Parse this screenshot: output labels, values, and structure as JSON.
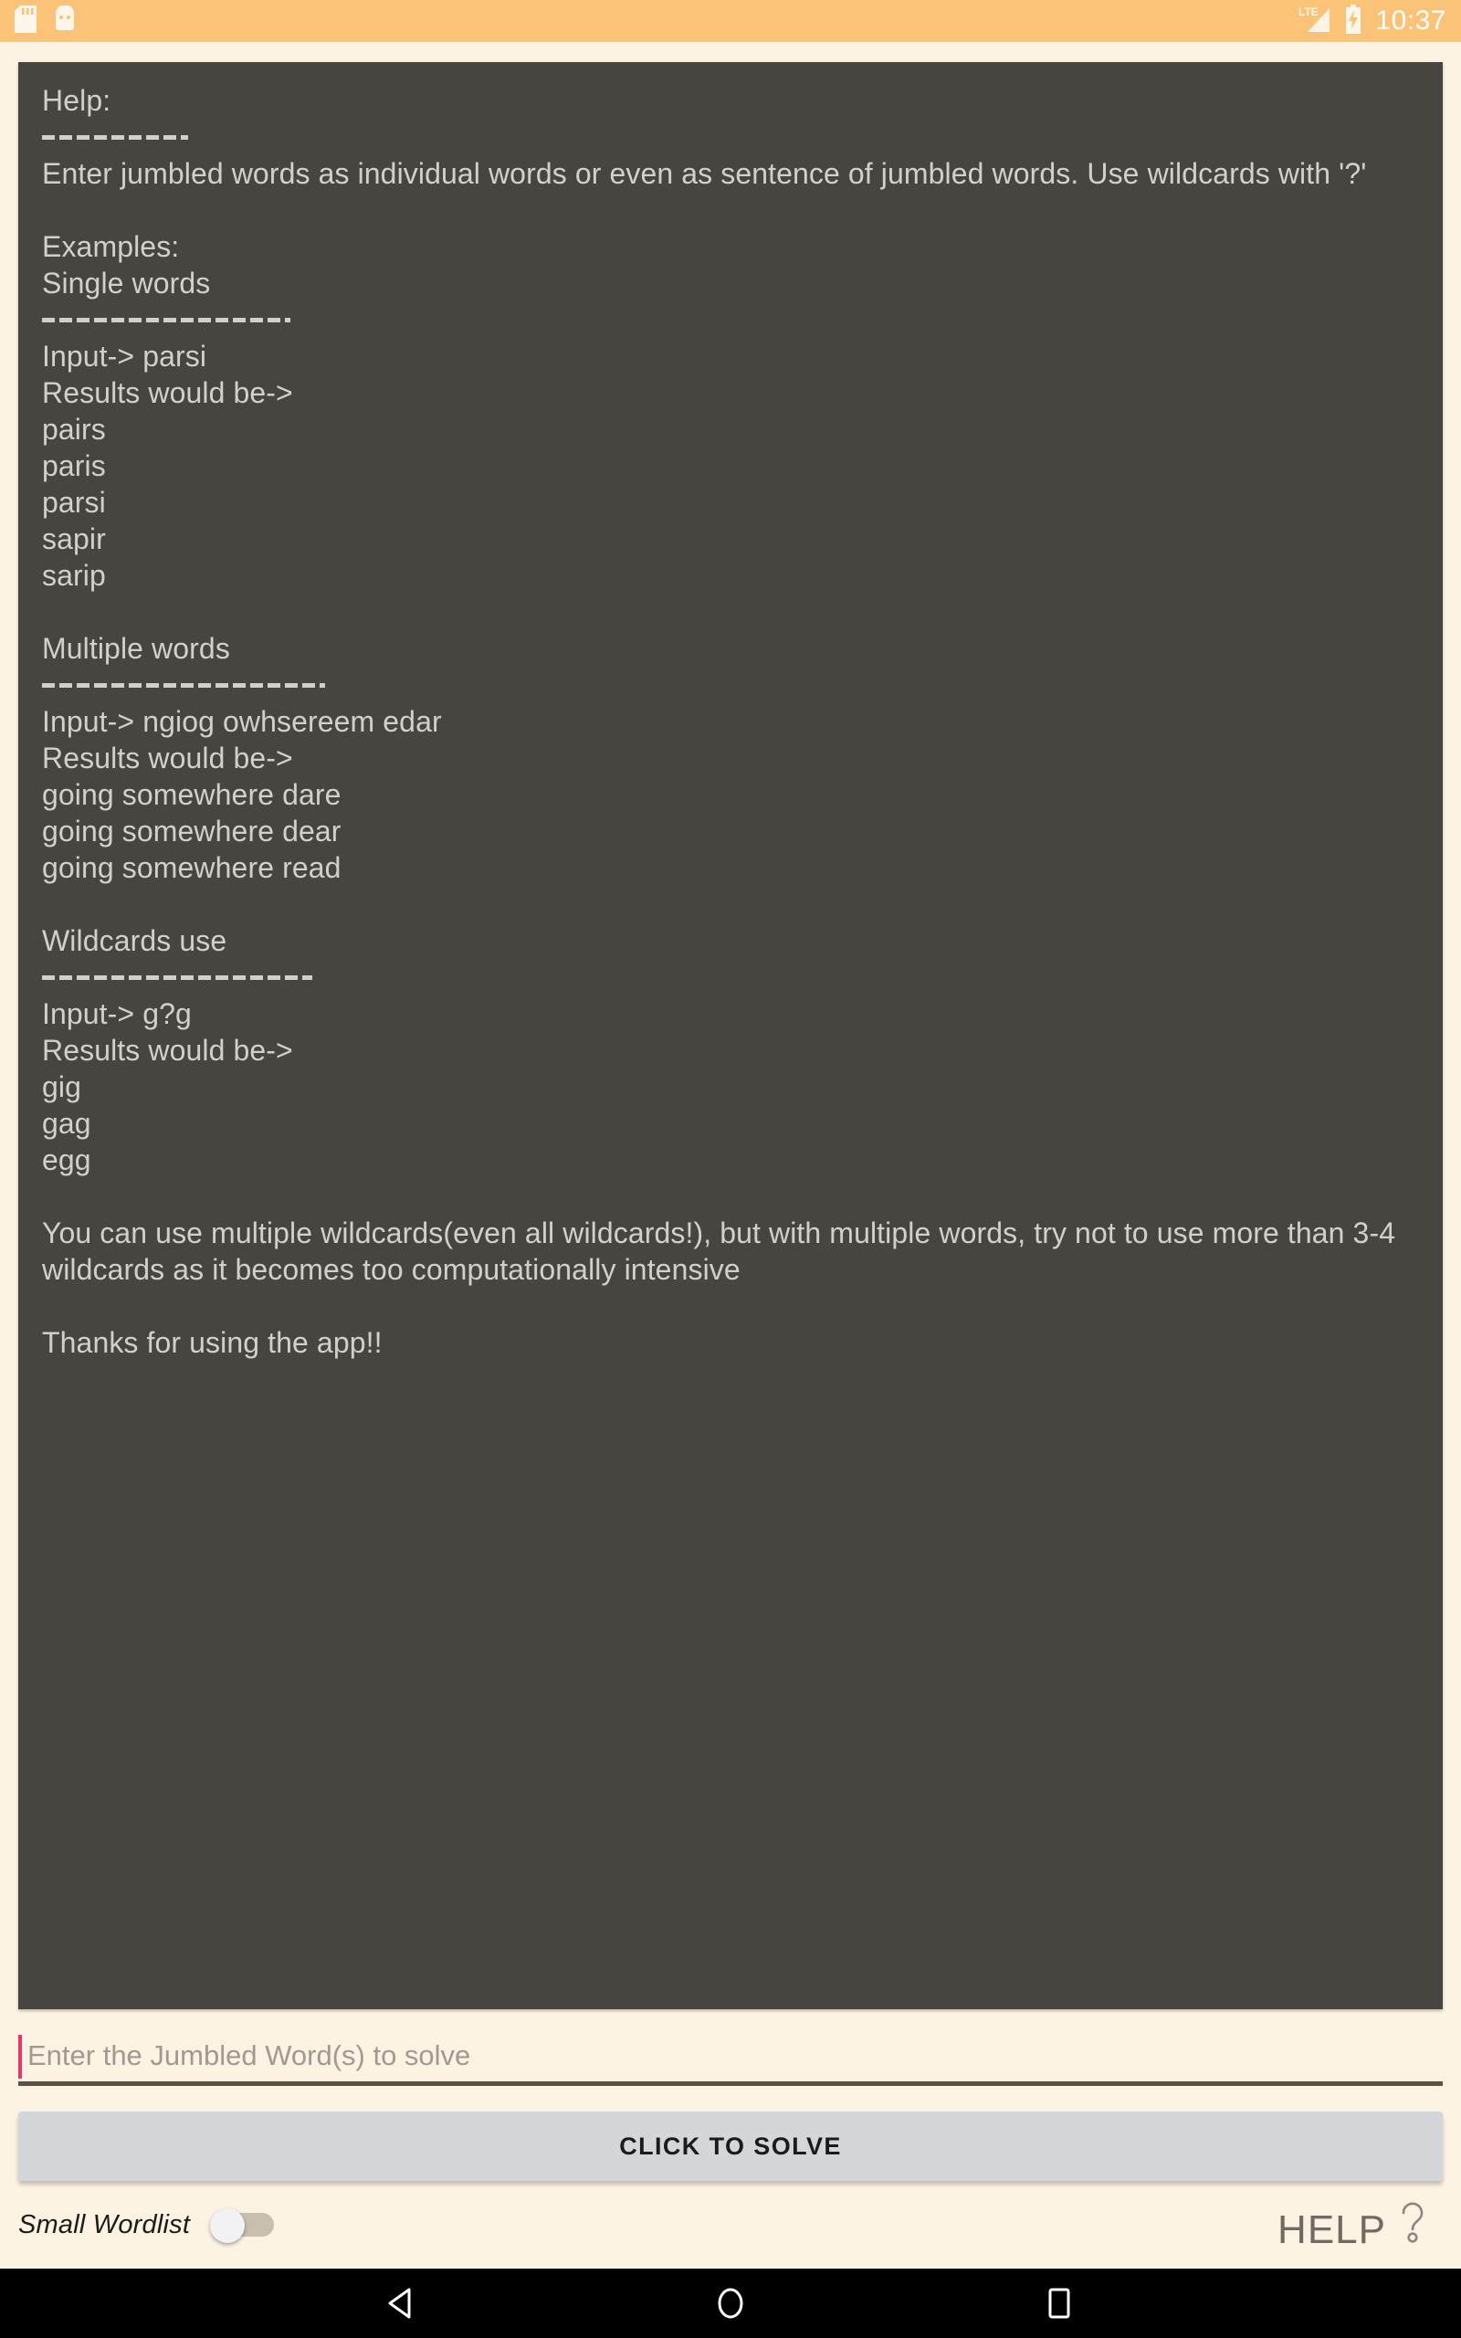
{
  "status_bar": {
    "icons_left": [
      "sd-card-icon",
      "android-icon"
    ],
    "network": "LTE",
    "battery": "battery-charging-icon",
    "clock": "10:37",
    "background": "#fac378"
  },
  "help_panel": {
    "background": "#484540",
    "text_color": "#d3d0cb",
    "lines": [
      {
        "type": "text",
        "text": "Help:"
      },
      {
        "type": "rule",
        "size": "short"
      },
      {
        "type": "text",
        "text": "Enter jumbled words as individual words or even as sentence of jumbled words. Use wildcards with '?'"
      },
      {
        "type": "blank"
      },
      {
        "type": "text",
        "text": "Examples:"
      },
      {
        "type": "text",
        "text": "Single words"
      },
      {
        "type": "rule",
        "size": "med"
      },
      {
        "type": "text",
        "text": "Input-> parsi"
      },
      {
        "type": "text",
        "text": "Results would be->"
      },
      {
        "type": "text",
        "text": "pairs"
      },
      {
        "type": "text",
        "text": "paris"
      },
      {
        "type": "text",
        "text": "parsi"
      },
      {
        "type": "text",
        "text": "sapir"
      },
      {
        "type": "text",
        "text": "sarip"
      },
      {
        "type": "blank"
      },
      {
        "type": "text",
        "text": "Multiple words"
      },
      {
        "type": "rule",
        "size": "wide"
      },
      {
        "type": "text",
        "text": "Input-> ngiog owhsereem edar"
      },
      {
        "type": "text",
        "text": "Results would be->"
      },
      {
        "type": "text",
        "text": "going somewhere dare"
      },
      {
        "type": "text",
        "text": "going somewhere dear"
      },
      {
        "type": "text",
        "text": "going somewhere read"
      },
      {
        "type": "blank"
      },
      {
        "type": "text",
        "text": "Wildcards use"
      },
      {
        "type": "rule",
        "size": "long"
      },
      {
        "type": "text",
        "text": "Input-> g?g"
      },
      {
        "type": "text",
        "text": "Results would be->"
      },
      {
        "type": "text",
        "text": "gig"
      },
      {
        "type": "text",
        "text": "gag"
      },
      {
        "type": "text",
        "text": "egg"
      },
      {
        "type": "blank"
      },
      {
        "type": "text",
        "text": "You can use multiple wildcards(even all wildcards!), but with multiple words, try not to use more than 3-4 wildcards as it becomes too computationally intensive"
      },
      {
        "type": "blank"
      },
      {
        "type": "text",
        "text": "Thanks for using the app!!"
      }
    ]
  },
  "input": {
    "placeholder": "Enter the Jumbled Word(s) to solve",
    "value": "",
    "caret_color": "#e8386b"
  },
  "solve_button": {
    "label": "CLICK TO SOLVE",
    "background": "#d3d7da"
  },
  "bottom": {
    "wordlist_label": "Small Wordlist",
    "toggle_state": "off",
    "help_label": "HELP",
    "help_icon": "question-mark-icon"
  },
  "nav_bar": {
    "back": "back-triangle-icon",
    "home": "home-circle-icon",
    "recents": "recents-square-icon"
  }
}
